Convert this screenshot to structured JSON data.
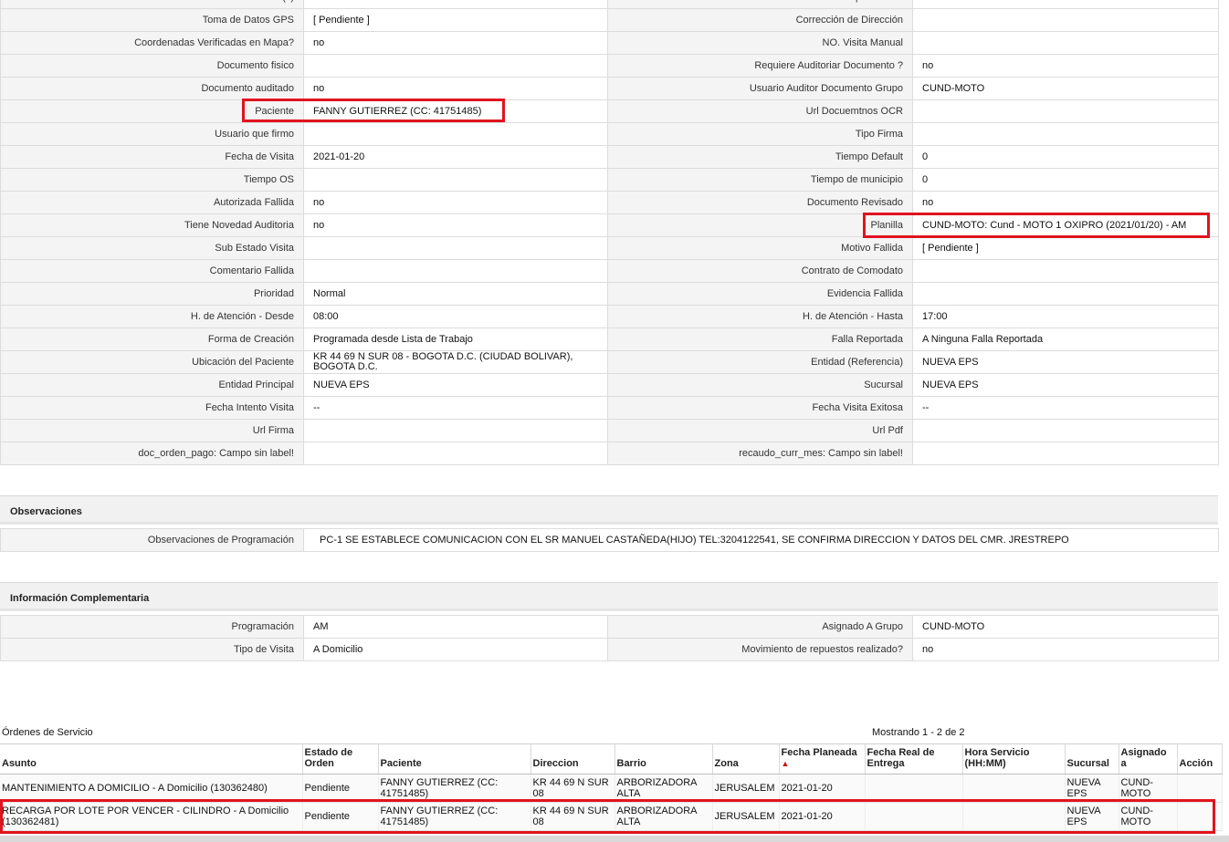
{
  "colors": {
    "highlight": "#e0141f",
    "label_bg": "#f4f4f4",
    "section_bg": "#f1f1f1"
  },
  "top_cut": {
    "left_label": "Recaudo Auditado (s)",
    "right_label": "Coordenadas Aprobadas?",
    "right_value": "no"
  },
  "fields": [
    {
      "l_label": "Toma de Datos GPS",
      "l_value": "[ Pendiente ]",
      "r_label": "Corrección de Dirección",
      "r_value": ""
    },
    {
      "l_label": "Coordenadas Verificadas en Mapa?",
      "l_value": " no",
      "r_label": "NO. Visita Manual",
      "r_value": ""
    },
    {
      "l_label": "Documento fisico",
      "l_value": "",
      "r_label": "Requiere Auditoriar Documento ?",
      "r_value": " no"
    },
    {
      "l_label": "Documento auditado",
      "l_value": " no",
      "r_label": "Usuario Auditor Documento Grupo",
      "r_value": "CUND-MOTO"
    },
    {
      "l_label": "Paciente",
      "l_value": "FANNY GUTIERREZ (CC: 41751485)",
      "r_label": "Url Docuemtnos OCR",
      "r_value": ""
    },
    {
      "l_label": "Usuario que firmo",
      "l_value": "",
      "r_label": "Tipo Firma",
      "r_value": ""
    },
    {
      "l_label": "Fecha de Visita",
      "l_value": " 2021-01-20",
      "r_label": "Tiempo Default",
      "r_value": "0"
    },
    {
      "l_label": "Tiempo OS",
      "l_value": "",
      "r_label": "Tiempo de municipio",
      "r_value": "0"
    },
    {
      "l_label": "Autorizada Fallida",
      "l_value": " no",
      "r_label": "Documento Revisado",
      "r_value": " no"
    },
    {
      "l_label": "Tiene Novedad Auditoria",
      "l_value": " no",
      "r_label": "Planilla",
      "r_value": "CUND-MOTO: Cund - MOTO 1 OXIPRO (2021/01/20) - AM"
    },
    {
      "l_label": "Sub Estado Visita",
      "l_value": "",
      "r_label": "Motivo Fallida",
      "r_value": "[ Pendiente ]"
    },
    {
      "l_label": "Comentario Fallida",
      "l_value": "",
      "r_label": "Contrato de Comodato",
      "r_value": ""
    },
    {
      "l_label": "Prioridad",
      "l_value": "Normal",
      "r_label": "Evidencia Fallida",
      "r_value": ""
    },
    {
      "l_label": "H. de Atención - Desde",
      "l_value": "08:00",
      "r_label": "H. de Atención - Hasta",
      "r_value": "17:00"
    },
    {
      "l_label": "Forma de Creación",
      "l_value": "Programada desde Lista de Trabajo",
      "r_label": "Falla Reportada",
      "r_value": "A Ninguna Falla Reportada"
    },
    {
      "l_label": "Ubicación del Paciente",
      "l_value": "KR 44 69 N SUR 08 - BOGOTA D.C. (CIUDAD BOLIVAR), BOGOTA D.C.",
      "r_label": "Entidad (Referencia)",
      "r_value": "NUEVA EPS"
    },
    {
      "l_label": "Entidad Principal",
      "l_value": "NUEVA EPS",
      "r_label": "Sucursal",
      "r_value": "NUEVA EPS"
    },
    {
      "l_label": "Fecha Intento Visita",
      "l_value": " --",
      "r_label": "Fecha Visita Exitosa",
      "r_value": " --"
    },
    {
      "l_label": "Url Firma",
      "l_value": "",
      "r_label": "Url Pdf",
      "r_value": ""
    },
    {
      "l_label": "doc_orden_pago: Campo sin label!",
      "l_value": "",
      "r_label": "recaudo_curr_mes: Campo sin label!",
      "r_value": ""
    }
  ],
  "observaciones": {
    "title": "Observaciones",
    "label": "Observaciones de Programación",
    "value": "PC-1 SE ESTABLECE COMUNICACION CON EL SR MANUEL CASTAÑEDA(HIJO) TEL:3204122541, SE CONFIRMA DIRECCION Y DATOS DEL CMR. JRESTREPO"
  },
  "complementaria": {
    "title": "Información Complementaria",
    "rows": [
      {
        "l_label": "Programación",
        "l_value": "AM",
        "r_label": "Asignado A Grupo",
        "r_value": "CUND-MOTO"
      },
      {
        "l_label": "Tipo de Visita",
        "l_value": "A Domicilio",
        "r_label": "Movimiento de repuestos realizado?",
        "r_value": " no"
      }
    ]
  },
  "orders": {
    "title": "Órdenes de Servicio",
    "count_text": "Mostrando 1 - 2 de 2",
    "sort_icon": "triangle-up-icon",
    "headers": [
      "Asunto",
      "Estado de Orden",
      "Paciente",
      "Direccion",
      "Barrio",
      "Zona",
      "Fecha Planeada",
      "Fecha Real de Entrega",
      "Hora Servicio (HH:MM)",
      "Sucursal",
      "Asignado a",
      "Acción"
    ],
    "rows": [
      [
        "MANTENIMIENTO A DOMICILIO - A Domicilio (130362480)",
        "Pendiente",
        "FANNY GUTIERREZ (CC: 41751485)",
        "KR 44 69 N SUR 08",
        "ARBORIZADORA ALTA",
        "JERUSALEM",
        "2021-01-20",
        "",
        "",
        "NUEVA EPS",
        "CUND-MOTO",
        ""
      ],
      [
        "RECARGA POR LOTE POR VENCER - CILINDRO - A Domicilio (130362481)",
        "Pendiente",
        "FANNY GUTIERREZ (CC: 41751485)",
        "KR 44 69 N SUR 08",
        "ARBORIZADORA ALTA",
        "JERUSALEM",
        "2021-01-20",
        "",
        "",
        "NUEVA EPS",
        "CUND-MOTO",
        ""
      ]
    ]
  }
}
